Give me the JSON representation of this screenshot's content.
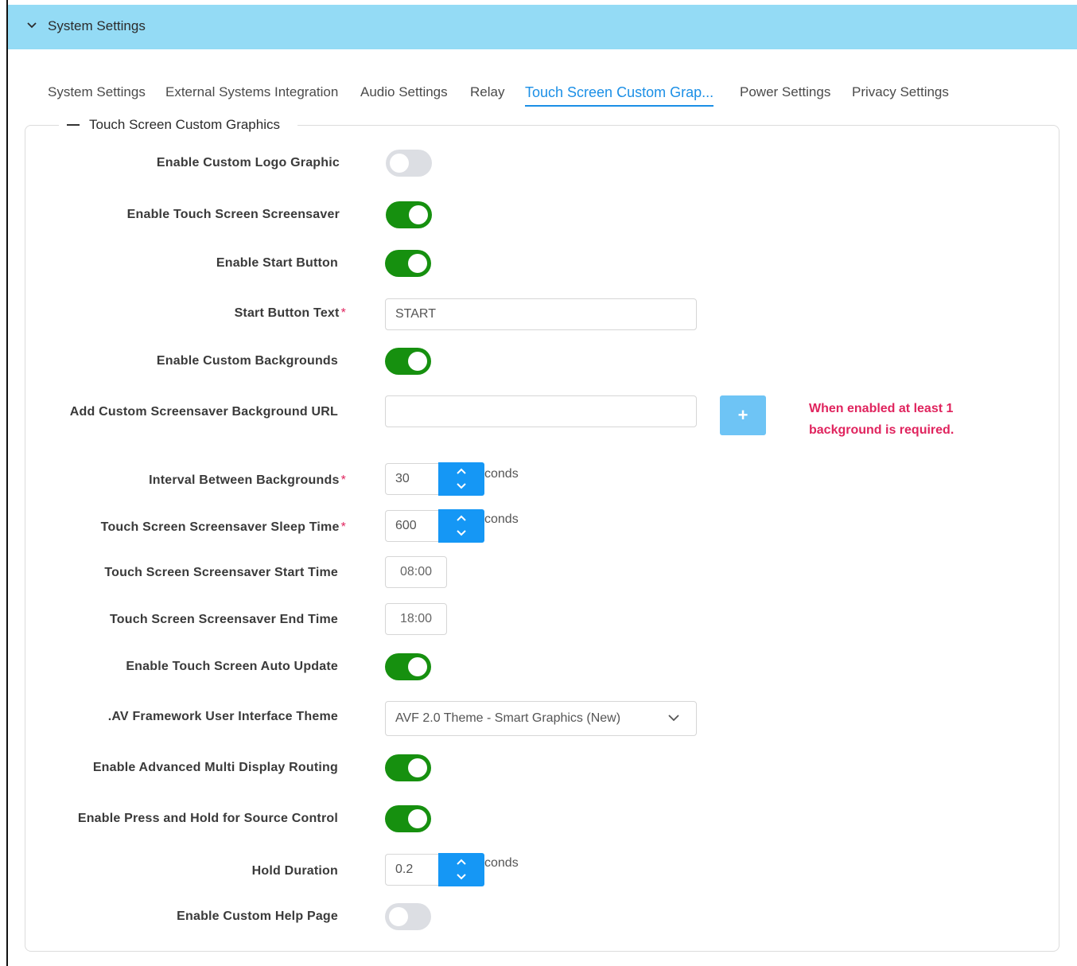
{
  "header": {
    "title": "System Settings"
  },
  "tabs": [
    {
      "label": "System Settings"
    },
    {
      "label": "External Systems Integration"
    },
    {
      "label": "Audio Settings"
    },
    {
      "label": "Relay"
    },
    {
      "label": "Touch Screen Custom Grap...",
      "active": true
    },
    {
      "label": "Power Settings"
    },
    {
      "label": "Privacy Settings"
    }
  ],
  "section": {
    "title": "Touch Screen Custom Graphics"
  },
  "fields": {
    "custom_logo": {
      "label": "Enable Custom Logo Graphic",
      "enabled": false
    },
    "screensaver": {
      "label": "Enable Touch Screen Screensaver",
      "enabled": true
    },
    "start_button": {
      "label": "Enable Start Button",
      "enabled": true
    },
    "start_text": {
      "label": "Start Button Text",
      "required_mark": "*",
      "value": "START"
    },
    "custom_backgrounds": {
      "label": "Enable Custom Backgrounds",
      "enabled": true
    },
    "bg_url": {
      "label": "Add Custom Screensaver Background URL",
      "value": "",
      "add_symbol": "+",
      "warning": "When enabled at least 1 background is required."
    },
    "interval": {
      "label": "Interval Between Backgrounds",
      "required_mark": "*",
      "value": "30",
      "unit": "conds"
    },
    "sleep_time": {
      "label": "Touch Screen Screensaver Sleep Time",
      "required_mark": "*",
      "value": "600",
      "unit": "conds"
    },
    "start_time": {
      "label": "Touch Screen Screensaver Start Time",
      "value": "08:00"
    },
    "end_time": {
      "label": "Touch Screen Screensaver End Time",
      "value": "18:00"
    },
    "auto_update": {
      "label": "Enable Touch Screen Auto Update",
      "enabled": true
    },
    "theme": {
      "label": ".AV Framework User Interface Theme",
      "value": "AVF 2.0 Theme - Smart Graphics (New)"
    },
    "multi_display": {
      "label": "Enable Advanced Multi Display Routing",
      "enabled": true
    },
    "press_hold": {
      "label": "Enable Press and Hold for Source Control",
      "enabled": true
    },
    "hold_duration": {
      "label": "Hold Duration",
      "value": "0.2",
      "unit": "conds"
    },
    "help_page": {
      "label": "Enable Custom Help Page",
      "enabled": false
    }
  },
  "colors": {
    "header_bg": "#94dbf5",
    "accent": "#1b8fe6",
    "toggle_on": "#16900f",
    "toggle_off": "#dcdee3",
    "warning": "#e0245e"
  }
}
